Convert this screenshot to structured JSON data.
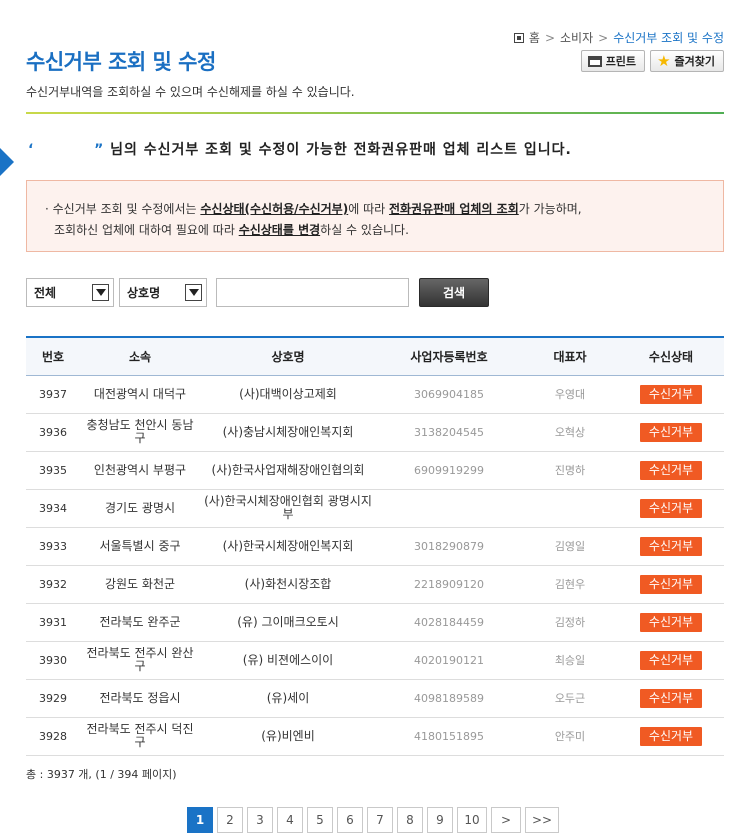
{
  "breadcrumb": {
    "home": "홈",
    "level1": "소비자",
    "current": "수신거부 조회 및 수정"
  },
  "page": {
    "title": "수신거부 조회 및 수정",
    "description": "수신거부내역을 조회하실 수 있으며 수신해제를 하실 수 있습니다."
  },
  "toolbar": {
    "print_label": "프린트",
    "favorite_label": "즐겨찾기"
  },
  "lead": {
    "open_quote": "‘",
    "close_quote": "”",
    "text": "님의 수신거부 조회 및 수정이 가능한 전화권유판매 업체 리스트 입니다."
  },
  "notice": {
    "p1": "· 수신거부 조회 및 수정에서는 ",
    "u1": "수신상태(수신허용/수신거부)",
    "p2": "에 따라 ",
    "u2": "전화권유판매 업체의 조회",
    "p3": "가 가능하며,",
    "p4": "조회하신 업체에 대하여 필요에 따라 ",
    "u3": "수신상태를 변경",
    "p5": "하실 수 있습니다."
  },
  "search": {
    "category_select": "전체",
    "field_select": "상호명",
    "input_value": "",
    "button_label": "검색"
  },
  "table": {
    "headers": [
      "번호",
      "소속",
      "상호명",
      "사업자등록번호",
      "대표자",
      "수신상태"
    ],
    "rows": [
      {
        "no": "3937",
        "region": "대전광역시 대덕구",
        "name": "(사)대백이상고제회",
        "biz": "3069904185",
        "rep": "우영대",
        "status": "수신거부"
      },
      {
        "no": "3936",
        "region": "충청남도 천안시 동남구",
        "name": "(사)충남시체장애인복지회",
        "biz": "3138204545",
        "rep": "오혁상",
        "status": "수신거부"
      },
      {
        "no": "3935",
        "region": "인천광역시 부평구",
        "name": "(사)한국사업재해장애인협의회",
        "biz": "6909919299",
        "rep": "진명하",
        "status": "수신거부"
      },
      {
        "no": "3934",
        "region": "경기도 광명시",
        "name": "(사)한국시체장애인협회 광명시지부",
        "biz": "",
        "rep": "",
        "status": "수신거부"
      },
      {
        "no": "3933",
        "region": "서울특별시 중구",
        "name": "(사)한국시체장애인복지회",
        "biz": "3018290879",
        "rep": "김영일",
        "status": "수신거부"
      },
      {
        "no": "3932",
        "region": "강원도 화천군",
        "name": "(사)화천시장조합",
        "biz": "2218909120",
        "rep": "김현우",
        "status": "수신거부"
      },
      {
        "no": "3931",
        "region": "전라북도 완주군",
        "name": "(유) 그이매크오토시",
        "biz": "4028184459",
        "rep": "김정하",
        "status": "수신거부"
      },
      {
        "no": "3930",
        "region": "전라북도 전주시 완산구",
        "name": "(유) 비젼에스이이",
        "biz": "4020190121",
        "rep": "최승일",
        "status": "수신거부"
      },
      {
        "no": "3929",
        "region": "전라북도 정읍시",
        "name": "(유)세이",
        "biz": "4098189589",
        "rep": "오두근",
        "status": "수신거부"
      },
      {
        "no": "3928",
        "region": "전라북도 전주시 덕진구",
        "name": "(유)비엔비",
        "biz": "4180151895",
        "rep": "안주미",
        "status": "수신거부"
      }
    ]
  },
  "summary": {
    "text": "총 : 3937 개, (1 / 394 페이지)"
  },
  "pagination": {
    "pages": [
      "1",
      "2",
      "3",
      "4",
      "5",
      "6",
      "7",
      "8",
      "9",
      "10"
    ],
    "current": "1",
    "next": ">",
    "last": ">>"
  },
  "colors": {
    "accent": "#1a73c6",
    "status_button": "#f05a23",
    "notice_bg": "#fdf2ee"
  },
  "icons": {
    "home": "home-icon",
    "print": "printer-icon",
    "favorite": "star-icon"
  }
}
